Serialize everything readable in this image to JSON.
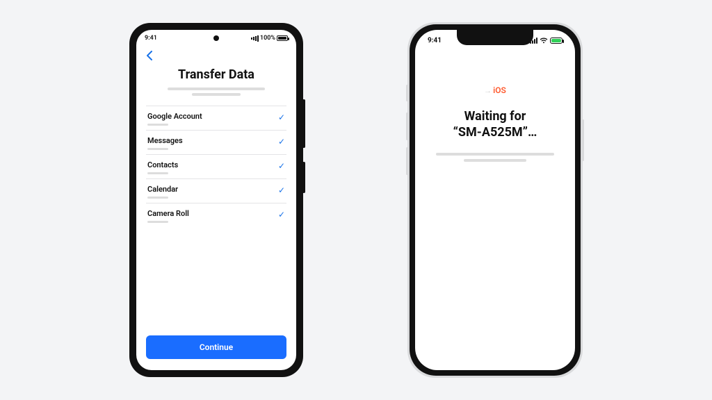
{
  "android": {
    "status": {
      "time": "9:41",
      "battery_text": "100%"
    },
    "title": "Transfer Data",
    "items": [
      {
        "label": "Google Account",
        "checked": true
      },
      {
        "label": "Messages",
        "checked": true
      },
      {
        "label": "Contacts",
        "checked": true
      },
      {
        "label": "Calendar",
        "checked": true
      },
      {
        "label": "Camera Roll",
        "checked": true
      }
    ],
    "continue_label": "Continue"
  },
  "iphone": {
    "status": {
      "time": "9:41"
    },
    "ios_badge": "iOS",
    "waiting_line1": "Waiting for",
    "waiting_line2": "“SM-A525M”…"
  },
  "colors": {
    "accent_blue": "#1a6dff",
    "ios_orange": "#ff5a2e",
    "battery_green": "#30d158"
  }
}
